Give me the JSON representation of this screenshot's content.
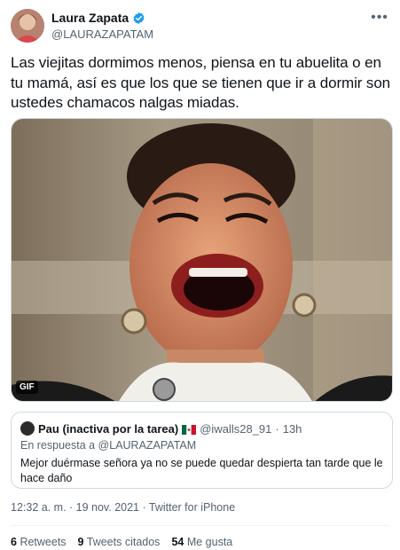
{
  "author": {
    "display_name": "Laura Zapata",
    "handle": "@LAURAZAPATAM",
    "verified": true,
    "avatar_icon": "user-avatar"
  },
  "tweet": {
    "text": "Las viejitas dormimos menos, piensa en tu abuelita o en tu mamá, así es que los que se tienen que ir a dormir son ustedes chamacos nalgas miadas.",
    "media_badge": "GIF"
  },
  "quote": {
    "name": "Pau (inactiva por la tarea)",
    "handle": "@iwalls28_91",
    "separator": "·",
    "time": "13h",
    "reply_to": "En respuesta a @LAURAZAPATAM",
    "text": "Mejor duérmase señora ya no se puede quedar despierta tan tarde que le hace daño"
  },
  "meta": {
    "timestamp": "12:32 a. m. · 19 nov. 2021 · Twitter for iPhone"
  },
  "stats": {
    "retweets_count": "6",
    "retweets_label": "Retweets",
    "quotes_count": "9",
    "quotes_label": "Tweets citados",
    "likes_count": "54",
    "likes_label": "Me gusta"
  },
  "colors": {
    "verified": "#1d9bf0",
    "text_primary": "#0f1419",
    "text_secondary": "#536471",
    "border": "#cfd9de"
  }
}
